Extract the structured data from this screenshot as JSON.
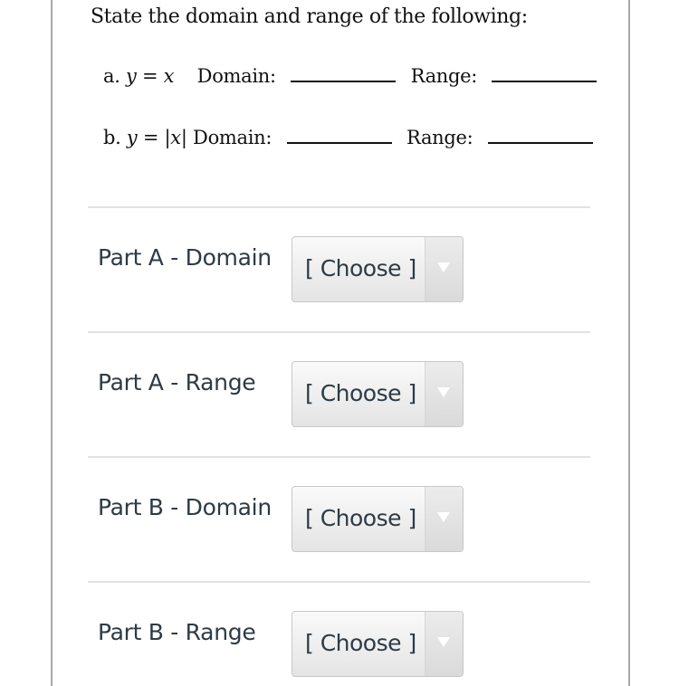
{
  "question": {
    "title": "State the domain and range of the following:",
    "rows": [
      {
        "prefix": "a.",
        "equation": "y = x",
        "domain_label": "Domain:",
        "range_label": "Range:"
      },
      {
        "prefix": "b.",
        "equation": "y = |x|",
        "domain_label": "Domain:",
        "range_label": "Range:"
      }
    ]
  },
  "parts": [
    {
      "label": "Part A - Domain",
      "selected": "[ Choose ]"
    },
    {
      "label": "Part A - Range",
      "selected": "[ Choose ]"
    },
    {
      "label": "Part B - Domain",
      "selected": "[ Choose ]"
    },
    {
      "label": "Part B - Range",
      "selected": "[ Choose ]"
    }
  ],
  "icons": {
    "dropdown": "triangle-down"
  }
}
